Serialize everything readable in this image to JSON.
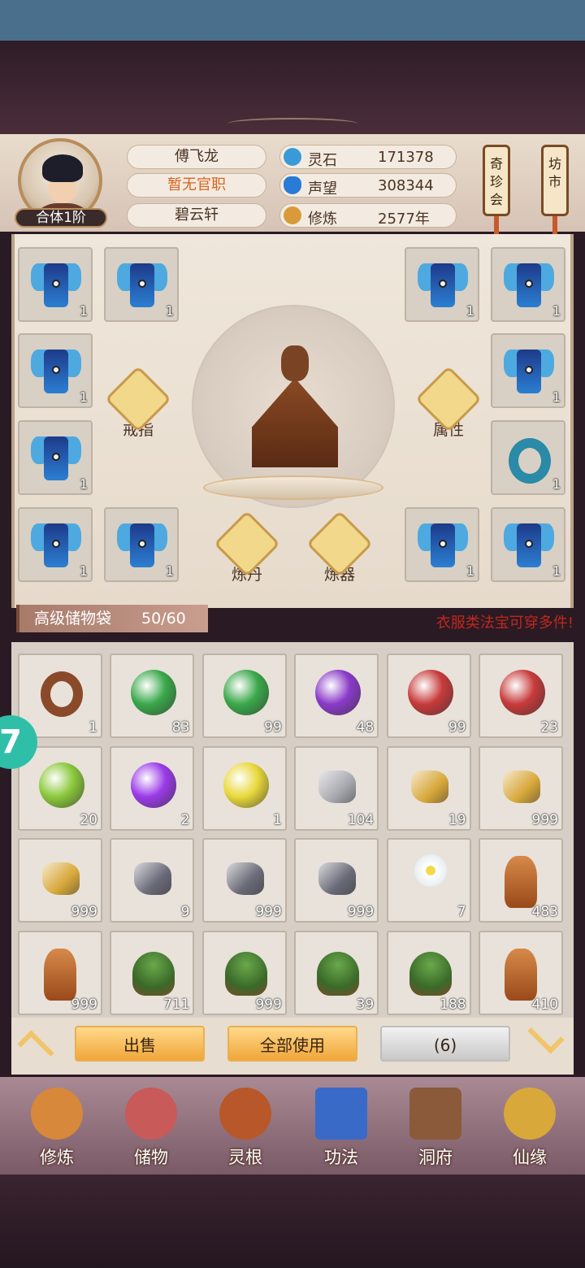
{
  "player": {
    "rank": "合体1阶",
    "name": "傅飞龙",
    "official_title": "暂无官职",
    "sect": "碧云轩"
  },
  "resources": [
    {
      "label": "灵石",
      "value": "171378",
      "icon": "spirit-stone-icon",
      "color": "#3a9ad8"
    },
    {
      "label": "声望",
      "value": "308344",
      "icon": "reputation-crystal-icon",
      "color": "#2a7ad8"
    },
    {
      "label": "修炼",
      "value": "2577年",
      "icon": "meditation-icon",
      "color": "#d89a3a"
    }
  ],
  "shops": {
    "treasure_hall": "奇珍会",
    "market": "坊市"
  },
  "equipment": {
    "ring_label": "戒指",
    "attributes_label": "属性",
    "alchemy_label": "炼丹",
    "forging_label": "炼器",
    "slots": [
      {
        "item": "robe",
        "count": "1"
      },
      {
        "item": "robe",
        "count": "1"
      },
      {
        "item": "robe",
        "count": "1"
      },
      {
        "item": "robe",
        "count": "1"
      },
      {
        "item": "robe",
        "count": "1"
      },
      {
        "item": "robe",
        "count": "1"
      },
      {
        "item": "robe",
        "count": "1"
      },
      {
        "item": "ring",
        "count": "1"
      },
      {
        "item": "robe",
        "count": "1"
      },
      {
        "item": "robe",
        "count": "1"
      },
      {
        "item": "robe",
        "count": "1"
      },
      {
        "item": "robe",
        "count": "1"
      }
    ]
  },
  "bag": {
    "title": "高级储物袋",
    "capacity": "50/60",
    "hint": "衣服类法宝可穿多件!"
  },
  "inventory": [
    {
      "item": "ring",
      "count": "1",
      "color": "#8a4a2a"
    },
    {
      "item": "orb",
      "count": "83",
      "color": "#3aa84a"
    },
    {
      "item": "orb",
      "count": "99",
      "color": "#3aa84a"
    },
    {
      "item": "orb",
      "count": "48",
      "color": "#8a3ac8"
    },
    {
      "item": "orb",
      "count": "99",
      "color": "#c83a3a"
    },
    {
      "item": "orb",
      "count": "23",
      "color": "#c83a3a"
    },
    {
      "item": "orb",
      "count": "20",
      "color": "#8ac83a"
    },
    {
      "item": "orb",
      "count": "2",
      "color": "#9a3ae8"
    },
    {
      "item": "orb",
      "count": "1",
      "color": "#e8d83a"
    },
    {
      "item": "stone",
      "count": "104",
      "color": "#a8a8b0"
    },
    {
      "item": "stone",
      "count": "19",
      "color": "#d8a83a"
    },
    {
      "item": "stone",
      "count": "999",
      "color": "#d8a83a"
    },
    {
      "item": "stone",
      "count": "999",
      "color": "#d8a83a"
    },
    {
      "item": "stone",
      "count": "9",
      "color": "#6a6a78"
    },
    {
      "item": "stone",
      "count": "999",
      "color": "#6a6a78"
    },
    {
      "item": "stone",
      "count": "999",
      "color": "#6a6a78"
    },
    {
      "item": "flower",
      "count": "7",
      "color": "#ffffff"
    },
    {
      "item": "root",
      "count": "483",
      "color": "#c8783a"
    },
    {
      "item": "root",
      "count": "999",
      "color": "#c8783a"
    },
    {
      "item": "herb",
      "count": "711",
      "color": "#5a8a3a"
    },
    {
      "item": "herb",
      "count": "999",
      "color": "#5a8a3a"
    },
    {
      "item": "herb",
      "count": "39",
      "color": "#5a8a3a"
    },
    {
      "item": "herb",
      "count": "188",
      "color": "#5a8a3a"
    },
    {
      "item": "root",
      "count": "410",
      "color": "#d86a2a"
    }
  ],
  "actions": {
    "sell": "出售",
    "use_all": "全部使用",
    "selected_count": "(6)"
  },
  "floating_button": "7",
  "nav": [
    {
      "label": "修炼",
      "icon": "cultivation-icon",
      "color": "#d8883a"
    },
    {
      "label": "储物",
      "icon": "storage-bag-icon",
      "color": "#c85a5a"
    },
    {
      "label": "灵根",
      "icon": "spirit-root-icon",
      "color": "#b8582a"
    },
    {
      "label": "功法",
      "icon": "technique-book-icon",
      "color": "#3a6ac8"
    },
    {
      "label": "洞府",
      "icon": "cave-dwelling-icon",
      "color": "#8a5a3a"
    },
    {
      "label": "仙缘",
      "icon": "immortal-fate-icon",
      "color": "#d8a83a"
    }
  ]
}
